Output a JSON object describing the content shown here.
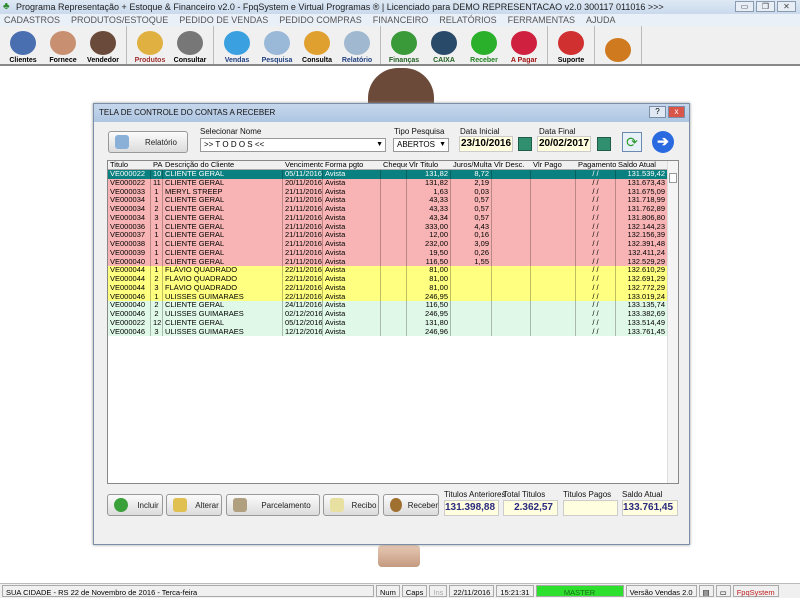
{
  "window": {
    "title": "Programa Representação + Estoque & Financeiro v2.0 - FpqSystem e Virtual Programas ® | Licenciado para  DEMO REPRESENTACAO v2.0 300117 011016 >>>",
    "min": "▭",
    "max": "❐",
    "close": "✕"
  },
  "menu": [
    "CADASTROS",
    "PRODUTOS/ESTOQUE",
    "PEDIDO DE VENDAS",
    "PEDIDO COMPRAS",
    "FINANCEIRO",
    "RELATÓRIOS",
    "FERRAMENTAS",
    "AJUDA"
  ],
  "toolbar": [
    [
      {
        "label": "Clientes",
        "color": "#4a6fb0",
        "text": "#000"
      },
      {
        "label": "Fornece",
        "color": "#c89070",
        "text": "#000"
      },
      {
        "label": "Vendedor",
        "color": "#6a4a3a",
        "text": "#000"
      }
    ],
    [
      {
        "label": "Produtos",
        "color": "#e0b040",
        "text": "#a03030"
      },
      {
        "label": "Consultar",
        "color": "#777",
        "text": "#000"
      }
    ],
    [
      {
        "label": "Vendas",
        "color": "#3aa0e0",
        "text": "#204080"
      },
      {
        "label": "Pesquisa",
        "color": "#9ab8d8",
        "text": "#204080"
      },
      {
        "label": "Consulta",
        "color": "#e0a030",
        "text": "#000"
      },
      {
        "label": "Relatório",
        "color": "#a0b8d0",
        "text": "#204080"
      }
    ],
    [
      {
        "label": "Finanças",
        "color": "#3a9a3a",
        "text": "#206020"
      },
      {
        "label": "CAIXA",
        "color": "#2a4a6a",
        "text": "#206020"
      },
      {
        "label": "Receber",
        "color": "#2ab02a",
        "text": "#208020"
      },
      {
        "label": "A Pagar",
        "color": "#d02040",
        "text": "#a01010"
      }
    ],
    [
      {
        "label": "Suporte",
        "color": "#d03030",
        "text": "#000"
      }
    ],
    [
      {
        "label": "",
        "color": "#d07a20",
        "text": "#000"
      }
    ]
  ],
  "dialog": {
    "title": "TELA DE CONTROLE DO CONTAS A RECEBER",
    "help": "?",
    "close": "x",
    "relatorio_label": "Relatório",
    "selecionar_nome_label": "Selecionar Nome",
    "selecionar_nome_value": ">> T O D O S <<",
    "tipo_pesquisa_label": "Tipo  Pesquisa",
    "tipo_pesquisa_value": "ABERTOS",
    "data_inicial_label": "Data Inicial",
    "data_inicial": "23/10/2016",
    "data_final_label": "Data Final",
    "data_final": "20/02/2017",
    "columns": [
      "Titulo",
      "PA",
      "Descrição do Cliente",
      "Vencimento",
      "Forma pgto",
      "Cheque",
      "Vlr Titulo",
      "Juros/Multa",
      "Vlr Desc.",
      "Vlr Pago",
      "Pagamento",
      "Saldo Atual"
    ],
    "rows": [
      {
        "s": "sel",
        "v": [
          "VE000022",
          "10",
          "CLIENTE GERAL",
          "05/11/2016",
          "Avista",
          "",
          "131,82",
          "8,72",
          "",
          "",
          "/ /",
          "131.539,42"
        ]
      },
      {
        "s": "red",
        "v": [
          "VE000022",
          "11",
          "CLIENTE GERAL",
          "20/11/2016",
          "Avista",
          "",
          "131,82",
          "2,19",
          "",
          "",
          "/ /",
          "131.673,43"
        ]
      },
      {
        "s": "red",
        "v": [
          "VE000033",
          "1",
          "MERYL STREEP",
          "21/11/2016",
          "Avista",
          "",
          "1,63",
          "0,03",
          "",
          "",
          "/ /",
          "131.675,09"
        ]
      },
      {
        "s": "red",
        "v": [
          "VE000034",
          "1",
          "CLIENTE GERAL",
          "21/11/2016",
          "Avista",
          "",
          "43,33",
          "0,57",
          "",
          "",
          "/ /",
          "131.718,99"
        ]
      },
      {
        "s": "red",
        "v": [
          "VE000034",
          "2",
          "CLIENTE GERAL",
          "21/11/2016",
          "Avista",
          "",
          "43,33",
          "0,57",
          "",
          "",
          "/ /",
          "131.762,89"
        ]
      },
      {
        "s": "red",
        "v": [
          "VE000034",
          "3",
          "CLIENTE GERAL",
          "21/11/2016",
          "Avista",
          "",
          "43,34",
          "0,57",
          "",
          "",
          "/ /",
          "131.806,80"
        ]
      },
      {
        "s": "red",
        "v": [
          "VE000036",
          "1",
          "CLIENTE GERAL",
          "21/11/2016",
          "Avista",
          "",
          "333,00",
          "4,43",
          "",
          "",
          "/ /",
          "132.144,23"
        ]
      },
      {
        "s": "red",
        "v": [
          "VE000037",
          "1",
          "CLIENTE GERAL",
          "21/11/2016",
          "Avista",
          "",
          "12,00",
          "0,16",
          "",
          "",
          "/ /",
          "132.156,39"
        ]
      },
      {
        "s": "red",
        "v": [
          "VE000038",
          "1",
          "CLIENTE GERAL",
          "21/11/2016",
          "Avista",
          "",
          "232,00",
          "3,09",
          "",
          "",
          "/ /",
          "132.391,48"
        ]
      },
      {
        "s": "red",
        "v": [
          "VE000039",
          "1",
          "CLIENTE GERAL",
          "21/11/2016",
          "Avista",
          "",
          "19,50",
          "0,26",
          "",
          "",
          "/ /",
          "132.411,24"
        ]
      },
      {
        "s": "red",
        "v": [
          "VE000040",
          "1",
          "CLIENTE GERAL",
          "21/11/2016",
          "Avista",
          "",
          "116,50",
          "1,55",
          "",
          "",
          "/ /",
          "132.529,29"
        ]
      },
      {
        "s": "yel",
        "v": [
          "VE000044",
          "1",
          "FLÁVIO QUADRADO",
          "22/11/2016",
          "Avista",
          "",
          "81,00",
          "",
          "",
          "",
          "/ /",
          "132.610,29"
        ]
      },
      {
        "s": "yel",
        "v": [
          "VE000044",
          "2",
          "FLÁVIO QUADRADO",
          "22/11/2016",
          "Avista",
          "",
          "81,00",
          "",
          "",
          "",
          "/ /",
          "132.691,29"
        ]
      },
      {
        "s": "yel",
        "v": [
          "VE000044",
          "3",
          "FLÁVIO QUADRADO",
          "22/11/2016",
          "Avista",
          "",
          "81,00",
          "",
          "",
          "",
          "/ /",
          "132.772,29"
        ]
      },
      {
        "s": "yel",
        "v": [
          "VE000046",
          "1",
          "ULISSES GUIMARAES",
          "22/11/2016",
          "Avista",
          "",
          "246,95",
          "",
          "",
          "",
          "/ /",
          "133.019,24"
        ]
      },
      {
        "s": "grn",
        "v": [
          "VE000040",
          "2",
          "CLIENTE GERAL",
          "24/11/2016",
          "Avista",
          "",
          "116,50",
          "",
          "",
          "",
          "/ /",
          "133.135,74"
        ]
      },
      {
        "s": "grn",
        "v": [
          "VE000046",
          "2",
          "ULISSES GUIMARAES",
          "02/12/2016",
          "Avista",
          "",
          "246,95",
          "",
          "",
          "",
          "/ /",
          "133.382,69"
        ]
      },
      {
        "s": "grn",
        "v": [
          "VE000022",
          "12",
          "CLIENTE GERAL",
          "05/12/2016",
          "Avista",
          "",
          "131,80",
          "",
          "",
          "",
          "/ /",
          "133.514,49"
        ]
      },
      {
        "s": "grn",
        "v": [
          "VE000046",
          "3",
          "ULISSES GUIMARAES",
          "12/12/2016",
          "Avista",
          "",
          "246,96",
          "",
          "",
          "",
          "/ /",
          "133.761,45"
        ]
      }
    ],
    "buttons": {
      "incluir": "Incluir",
      "alterar": "Alterar",
      "parcelamento": "Parcelamento",
      "recibo": "Recibo",
      "receber": "Receber"
    },
    "totals": {
      "anteriores_label": "Titulos Anteriores",
      "anteriores": "131.398,88",
      "total_label": "Total Titulos",
      "total": "2.362,57",
      "pagos_label": "Titulos Pagos",
      "pagos": "",
      "saldo_label": "Saldo Atual",
      "saldo": "133.761,45"
    }
  },
  "status": {
    "cidade": "SUA CIDADE - RS 22 de Novembro de 2016 - Terca-feira",
    "num": "Num",
    "caps": "Caps",
    "ins": "Ins",
    "date": "22/11/2016",
    "time": "15:21:31",
    "user": "MASTER",
    "versao": "Versão Vendas 2.0",
    "brand": "FpqSystem"
  },
  "colors": {
    "sel": "#0a8080",
    "red": "#f8b4b4",
    "yel": "#ffff80",
    "grn": "#e0f8e8",
    "accent": "#2a2a80"
  }
}
